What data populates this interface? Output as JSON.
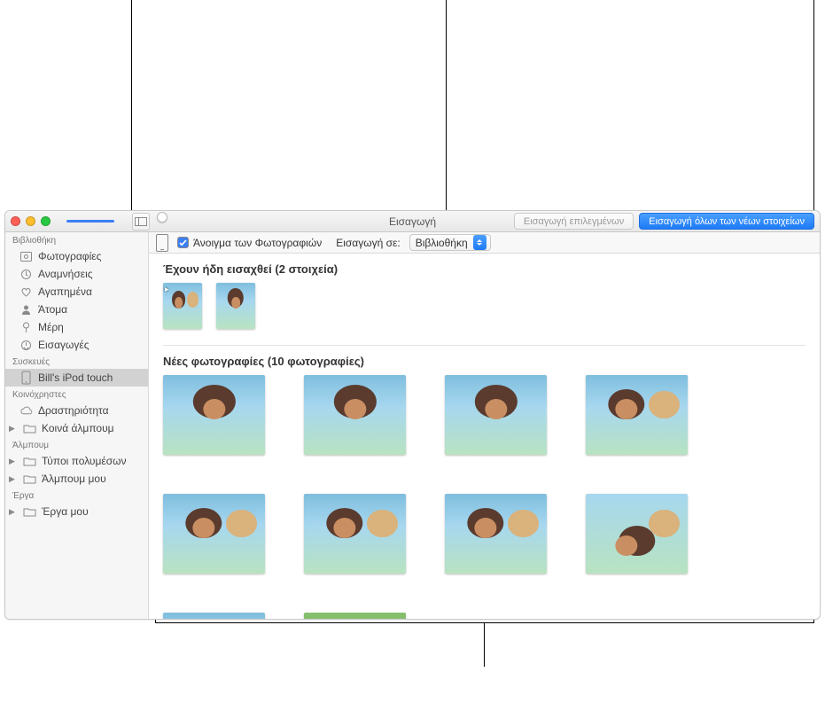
{
  "titlebar": {
    "title": "Εισαγωγή",
    "import_selected_label": "Εισαγωγή επιλεγμένων",
    "import_all_label": "Εισαγωγή όλων των νέων στοιχείων"
  },
  "subbar": {
    "open_photos_label": "Άνοιγμα των Φωτογραφιών",
    "import_to_label": "Εισαγωγή σε:",
    "import_to_value": "Βιβλιοθήκη"
  },
  "sidebar": {
    "library_header": "Βιβλιοθήκη",
    "library_items": [
      {
        "label": "Φωτογραφίες"
      },
      {
        "label": "Αναμνήσεις"
      },
      {
        "label": "Αγαπημένα"
      },
      {
        "label": "Άτομα"
      },
      {
        "label": "Μέρη"
      },
      {
        "label": "Εισαγωγές"
      }
    ],
    "devices_header": "Συσκευές",
    "devices_items": [
      {
        "label": "Bill's iPod touch",
        "selected": true
      }
    ],
    "shared_header": "Κοινόχρηστες",
    "shared_items": [
      {
        "label": "Δραστηριότητα"
      },
      {
        "label": "Κοινά άλμπουμ",
        "disclosure": true
      }
    ],
    "albums_header": "Άλμπουμ",
    "albums_items": [
      {
        "label": "Τύποι πολυμέσων",
        "disclosure": true
      },
      {
        "label": "Άλμπουμ μου",
        "disclosure": true
      }
    ],
    "projects_header": "Έργα",
    "projects_items": [
      {
        "label": "Έργα μου",
        "disclosure": true
      }
    ]
  },
  "sections": {
    "already_imported_title": "Έχουν ήδη εισαχθεί (2 στοιχεία)",
    "new_photos_title": "Νέες φωτογραφίες (10 φωτογραφίες)"
  }
}
